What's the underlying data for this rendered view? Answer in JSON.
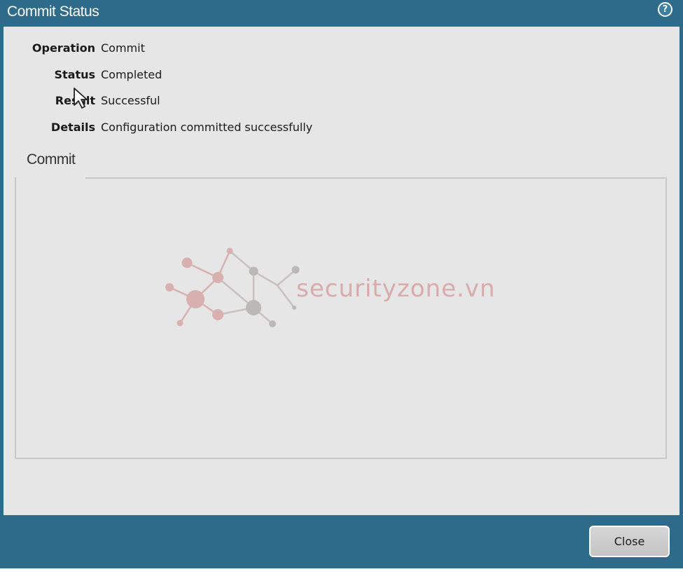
{
  "dialog": {
    "title": "Commit Status",
    "help_icon": "question-circle-icon"
  },
  "fields": [
    {
      "label": "Operation",
      "value": "Commit"
    },
    {
      "label": "Status",
      "value": "Completed"
    },
    {
      "label": "Result",
      "value": "Successful"
    },
    {
      "label": "Details",
      "value": "Configuration committed successfully"
    }
  ],
  "section": {
    "tab_label": "Commit"
  },
  "watermark": {
    "text": "securityzone.vn"
  },
  "footer": {
    "close_label": "Close"
  },
  "colors": {
    "title_bar": "#2e6a8a",
    "body_bg": "#e6e6e6",
    "watermark": "#d6a0a0"
  }
}
